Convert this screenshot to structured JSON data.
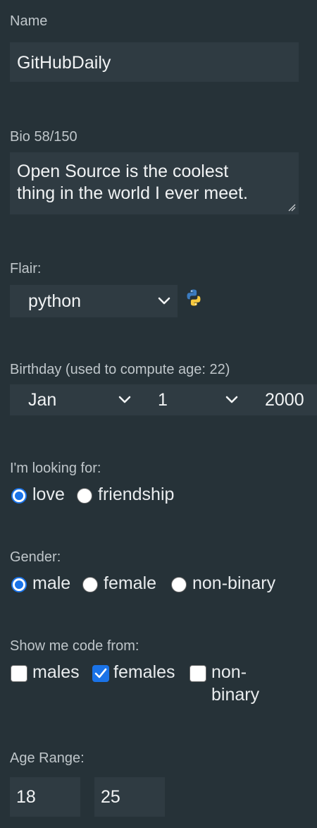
{
  "name": {
    "label": "Name",
    "value": "GitHubDaily"
  },
  "bio": {
    "label": "Bio 58/150",
    "line1": "Open Source is the coolest",
    "line2": "thing in the world I ever meet."
  },
  "flair": {
    "label": "Flair:",
    "selected": "python",
    "icon": "python-logo-icon"
  },
  "birthday": {
    "label": "Birthday (used to compute age: 22)",
    "month": "Jan",
    "day": "1",
    "year": "2000"
  },
  "looking_for": {
    "label": "I'm looking for:",
    "options": [
      {
        "label": "love",
        "checked": true
      },
      {
        "label": "friendship",
        "checked": false
      }
    ]
  },
  "gender": {
    "label": "Gender:",
    "options": [
      {
        "label": "male",
        "checked": true
      },
      {
        "label": "female",
        "checked": false
      },
      {
        "label": "non-binary",
        "checked": false
      }
    ]
  },
  "show_me": {
    "label": "Show me code from:",
    "options": [
      {
        "label": "males",
        "checked": false
      },
      {
        "label": "females",
        "checked": true
      },
      {
        "label_line1": "non-",
        "label_line2": "binary",
        "checked": false
      }
    ]
  },
  "age_range": {
    "label": "Age Range:",
    "min": "18",
    "max": "25"
  },
  "colors": {
    "background": "#263238",
    "field": "#2f3b42",
    "accent": "#1a73e8"
  }
}
